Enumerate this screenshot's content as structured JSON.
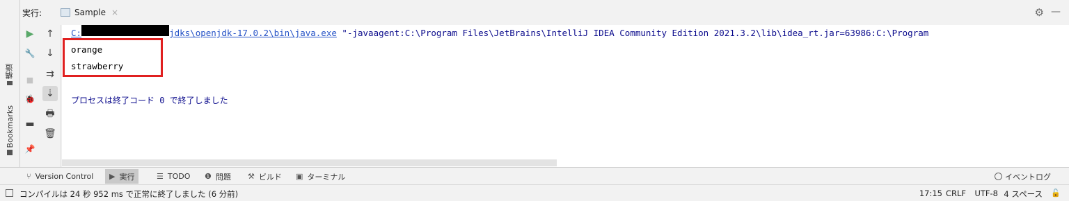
{
  "side": {
    "structure_label": "構造",
    "bookmarks_label": "Bookmarks"
  },
  "header": {
    "title": "実行:",
    "run_tab": "Sample",
    "close_glyph": "×"
  },
  "icons": {
    "gear": "⚙",
    "minimize": "—",
    "rerun": "▶",
    "wrench": "🔧",
    "stop": "■",
    "debug": "🐞",
    "layout": "▬",
    "pin": "📌",
    "up": "↑",
    "down": "↓",
    "soft_wrap": "⇉",
    "scroll_end": "⇣",
    "print": "🖶",
    "trash": "🗑"
  },
  "console": {
    "cmd_prefix": "C:",
    "cmd_path": "jdks\\openjdk-17.0.2\\bin\\java.exe",
    "cmd_args": " \"-javaagent:C:\\Program Files\\JetBrains\\IntelliJ IDEA Community Edition 2021.3.2\\lib\\idea_rt.jar=63986:C:\\Program",
    "output": [
      "orange",
      "strawberry"
    ],
    "exit_message": "プロセスは終了コード 0 で終了しました"
  },
  "bottom_tabs": [
    {
      "icon": "⑂",
      "label": "Version Control"
    },
    {
      "icon": "▶",
      "label": "実行"
    },
    {
      "icon": "☰",
      "label": "TODO"
    },
    {
      "icon": "❶",
      "label": "問題"
    },
    {
      "icon": "⚒",
      "label": "ビルド"
    },
    {
      "icon": "▣",
      "label": "ターミナル"
    }
  ],
  "event_log": "イベントログ",
  "status": {
    "message": "コンパイルは 24 秒 952 ms で正常に終了しました (6 分前)",
    "position": "17:15",
    "line_sep": "CRLF",
    "encoding": "UTF-8",
    "indent": "4 スペース",
    "lock_glyph": "🔓"
  },
  "colors": {
    "exit_text": "#0b0b8c",
    "link": "#2653c7",
    "highlight": "#e02020",
    "run_green": "#59a869"
  }
}
